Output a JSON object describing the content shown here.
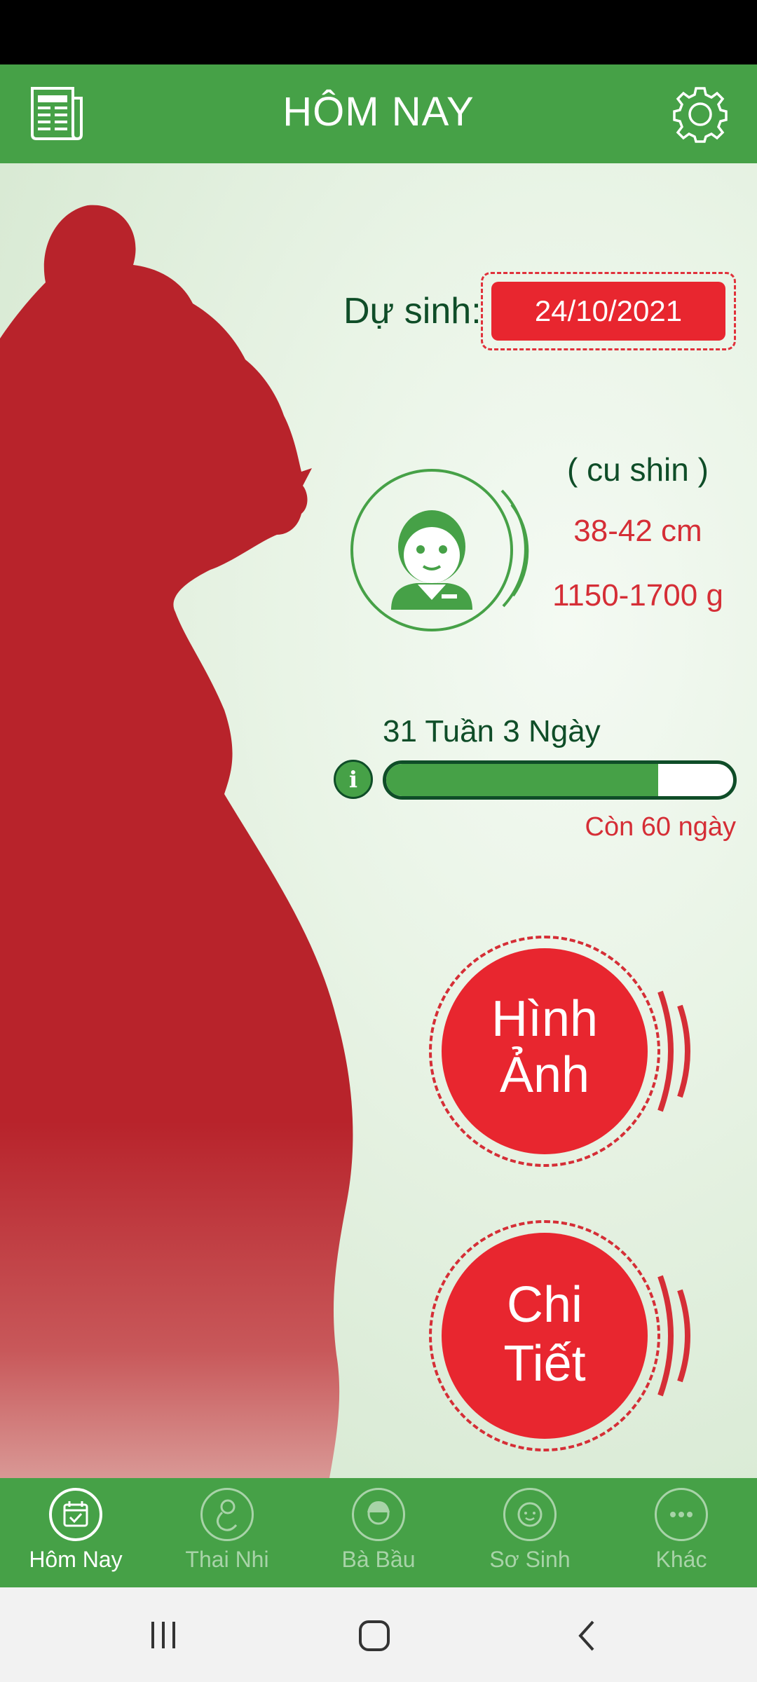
{
  "header": {
    "title": "HÔM NAY"
  },
  "due_date": {
    "label": "Dự sinh:",
    "value": "24/10/2021"
  },
  "baby_size": {
    "name": "( cu shin )",
    "length": "38-42 cm",
    "weight": "1150-1700 g"
  },
  "pregnancy_progress": {
    "label": "31 Tuần 3 Ngày",
    "progress_percent": 78.4,
    "remaining": "Còn 60 ngày"
  },
  "actions": {
    "images_line1": "Hình",
    "images_line2": "Ảnh",
    "details_line1": "Chi",
    "details_line2": "Tiết"
  },
  "bottom_nav": {
    "items": [
      {
        "label": "Hôm Nay",
        "icon": "calendar-check-icon",
        "active": true
      },
      {
        "label": "Thai Nhi",
        "icon": "fetus-icon",
        "active": false
      },
      {
        "label": "Bà Bầu",
        "icon": "mother-icon",
        "active": false
      },
      {
        "label": "Sơ Sinh",
        "icon": "baby-face-icon",
        "active": false
      },
      {
        "label": "Khác",
        "icon": "more-icon",
        "active": false
      }
    ]
  },
  "colors": {
    "primary_green": "#46a147",
    "dark_green": "#0f4d28",
    "accent_red": "#e8262f",
    "silhouette_red": "#b8232b"
  }
}
